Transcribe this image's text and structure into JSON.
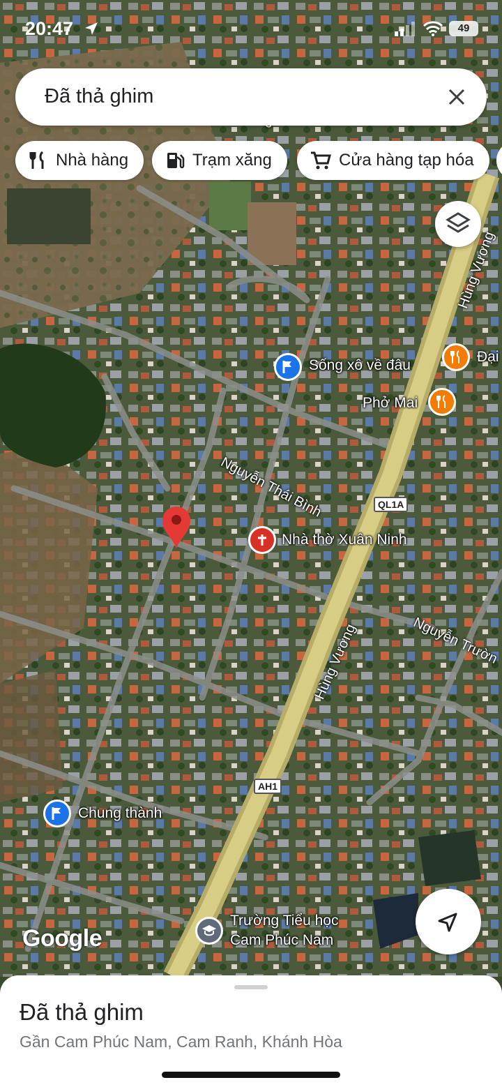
{
  "status_bar": {
    "time": "20:47",
    "battery": "49"
  },
  "search": {
    "query": "Đã thả ghim"
  },
  "chips": [
    {
      "label": "Nhà hàng",
      "icon": "fork-knife-icon"
    },
    {
      "label": "Trạm xăng",
      "icon": "gas-station-icon"
    },
    {
      "label": "Cửa hàng tạp hóa",
      "icon": "cart-icon"
    }
  ],
  "places": {
    "song_xo": "Sống xô về đâu",
    "pho_mai": "Phở Mai",
    "dai": "Đại",
    "church": "Nhà thờ Xuân Ninh",
    "chung_thanh": "Chung thành",
    "school_line1": "Trường Tiểu học",
    "school_line2": "Cam Phúc Nam"
  },
  "roads": {
    "hung_vuong_top": "Hùng Vương",
    "hung_vuong_mid": "Hùng Vương",
    "nguyen_thai_binh": "Nguyễn Thái Bình",
    "nguyen_truong": "Nguyễn Trườn",
    "top_partial": "rung",
    "shield_ql1a": "QL1A",
    "shield_ah1": "AH1"
  },
  "attribution": "Google",
  "sheet": {
    "title": "Đã thả ghim",
    "subtitle": "Gần Cam Phúc Nam, Cam Ranh, Khánh Hòa"
  },
  "colors": {
    "pin": "#e53935",
    "poi_blue": "#1a73e8",
    "poi_orange": "#f57c00",
    "poi_church": "#d93025",
    "poi_school": "#5f6b7a"
  }
}
